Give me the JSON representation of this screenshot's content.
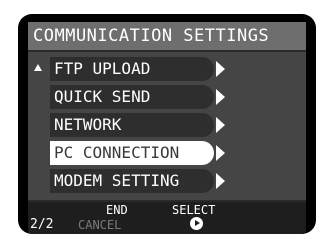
{
  "title": "COMMUNICATION SETTINGS",
  "menu": {
    "items": [
      {
        "label": "FTP UPLOAD",
        "icon": "chevron-right-icon"
      },
      {
        "label": "QUICK SEND",
        "icon": "chevron-right-icon"
      },
      {
        "label": "NETWORK",
        "icon": "chevron-right-icon"
      },
      {
        "label": "PC CONNECTION",
        "icon": "chevron-right-icon",
        "selected": true
      },
      {
        "label": "MODEM SETTING",
        "icon": "chevron-right-icon"
      }
    ],
    "scroll_indicator_icon": "triangle-up-icon"
  },
  "footer": {
    "end_label": "END",
    "select_label": "SELECT",
    "page": "2/2",
    "cancel_label": "CANCEL",
    "select_icon": "circle-play-icon"
  },
  "colors": {
    "screen_bg": "#000000",
    "panel_bg": "#454545",
    "title_bg": "#6e6e6e",
    "item_bg": "#2e2e2e",
    "selected_bg": "#ffffff",
    "footer_bg": "#1e1e1e",
    "disabled_text": "#7a7a7a"
  }
}
